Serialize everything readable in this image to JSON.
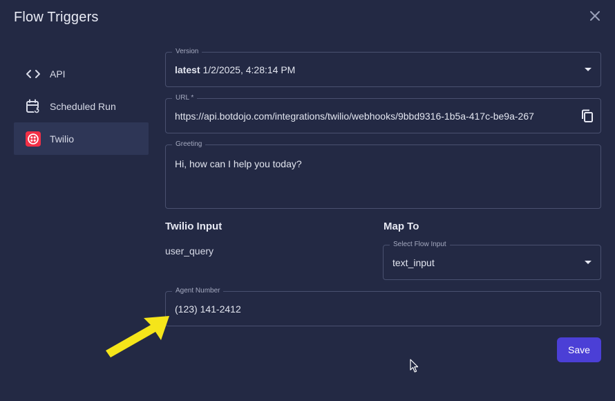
{
  "dialog": {
    "title": "Flow Triggers",
    "close_icon": "close-icon"
  },
  "sidebar": {
    "items": [
      {
        "label": "API",
        "icon": "code-icon",
        "active": false
      },
      {
        "label": "Scheduled Run",
        "icon": "calendar-refresh-icon",
        "active": false
      },
      {
        "label": "Twilio",
        "icon": "twilio-icon",
        "active": true
      }
    ]
  },
  "form": {
    "version": {
      "label": "Version",
      "tag": "latest",
      "value": "1/2/2025, 4:28:14 PM"
    },
    "url": {
      "label": "URL *",
      "value": "https://api.botdojo.com/integrations/twilio/webhooks/9bbd9316-1b5a-417c-be9a-267",
      "copy_icon": "copy-icon"
    },
    "greeting": {
      "label": "Greeting",
      "value": "Hi, how can I help you today?"
    },
    "mapping": {
      "input_header": "Twilio Input",
      "map_header": "Map To",
      "input_value": "user_query",
      "select_label": "Select Flow Input",
      "select_value": "text_input"
    },
    "agent_number": {
      "label": "Agent Number",
      "value": "(123) 141-2412"
    },
    "save_label": "Save"
  },
  "colors": {
    "background": "#232944",
    "accent": "#4b3fd6",
    "twilio": "#f22f46",
    "annotation": "#f5e51a"
  }
}
